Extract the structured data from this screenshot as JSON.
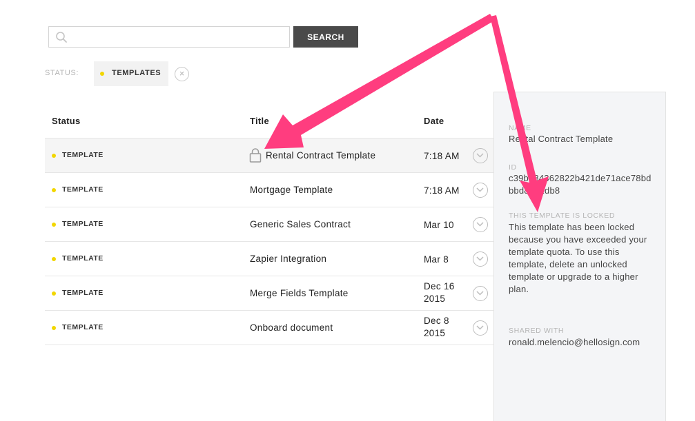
{
  "search": {
    "placeholder": "",
    "value": "",
    "button_label": "SEARCH"
  },
  "filter": {
    "label": "STATUS:",
    "chip_label": "TEMPLATES",
    "clear_symbol": "×"
  },
  "table": {
    "headers": {
      "status": "Status",
      "title": "Title",
      "date": "Date"
    },
    "rows": [
      {
        "status": "TEMPLATE",
        "title": "Rental Contract Template",
        "date": "7:18 AM",
        "locked": true,
        "selected": true
      },
      {
        "status": "TEMPLATE",
        "title": "Mortgage Template",
        "date": "7:18 AM"
      },
      {
        "status": "TEMPLATE",
        "title": "Generic Sales Contract",
        "date": "Mar 10"
      },
      {
        "status": "TEMPLATE",
        "title": "Zapier Integration",
        "date": "Mar 8"
      },
      {
        "status": "TEMPLATE",
        "title": "Merge Fields Template",
        "date": "Dec 16 2015"
      },
      {
        "status": "TEMPLATE",
        "title": "Onboard document",
        "date": "Dec 8 2015"
      }
    ]
  },
  "detail": {
    "name_label": "NAME",
    "name_value": "Rental Contract Template",
    "id_label": "ID",
    "id_value": "c39b784362822b421de71ace78bdbbd8901db8",
    "locked_label": "THIS TEMPLATE IS LOCKED",
    "locked_text": "This template has been locked because you have exceeded your template quota. To use this template, delete an unlocked template or upgrade to a higher plan.",
    "shared_label": "SHARED WITH",
    "shared_value": "ronald.melencio@hellosign.com"
  },
  "colors": {
    "status_dot": "#f2d600",
    "search_button": "#4a4a4a",
    "arrow": "#ff3d7f",
    "panel_bg": "#f4f5f7"
  },
  "icons": [
    "search-icon",
    "close-icon",
    "lock-icon",
    "chevron-down-icon"
  ]
}
